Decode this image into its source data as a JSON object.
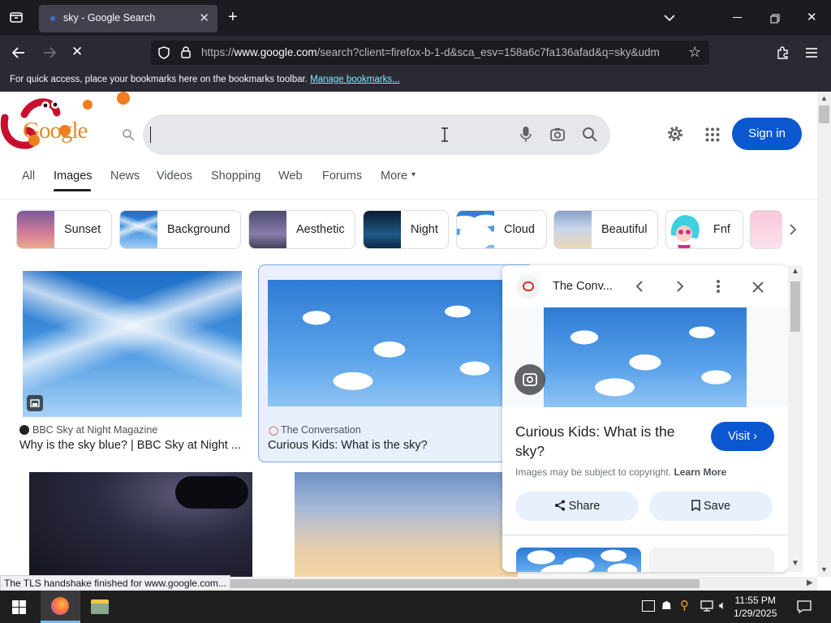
{
  "browser": {
    "tab_title": "sky - Google Search",
    "url_prefix": "https://",
    "url_host": "www.google.com",
    "url_path": "/search?client=firefox-b-1-d&sca_esv=158a6c7fa136afad&q=sky&udm",
    "bookmarks_text": "For quick access, place your bookmarks here on the bookmarks toolbar.",
    "bookmarks_link": "Manage bookmarks..."
  },
  "google": {
    "logo_text": "Google",
    "search_value": "",
    "sign_in": "Sign in",
    "tabs": [
      "All",
      "Images",
      "News",
      "Videos",
      "Shopping",
      "Web",
      "Forums",
      "More"
    ],
    "chips": [
      "Sunset",
      "Background",
      "Aesthetic",
      "Night",
      "Cloud",
      "Beautiful",
      "Fnf"
    ]
  },
  "results": [
    {
      "source": "BBC Sky at Night Magazine",
      "title": "Why is the sky blue? | BBC Sky at Night ..."
    },
    {
      "source": "The Conversation",
      "title": "Curious Kids: What is the sky?"
    }
  ],
  "panel": {
    "source": "The Conv...",
    "title_line1": "Curious Kids: What is the",
    "title_line2": "sky?",
    "visit": "Visit",
    "copyright": "Images may be subject to copyright.",
    "learn_more": "Learn More",
    "share": "Share",
    "save": "Save"
  },
  "status": "The TLS handshake finished for www.google.com...",
  "taskbar": {
    "time": "11:55 PM",
    "date": "1/29/2025"
  },
  "colors": {
    "accent": "#0b57d0",
    "chrome_dark": "#1c1b22",
    "link_cyan": "#80ebff"
  }
}
